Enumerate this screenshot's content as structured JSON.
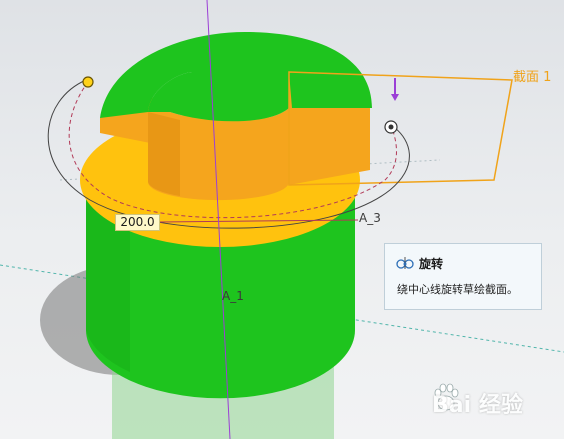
{
  "viewport": {
    "section_label": "截面 1",
    "dimension_value": "200.0",
    "axis_labels": {
      "a3": "A_3",
      "a1": "A_1"
    }
  },
  "tooltip": {
    "icon": "revolve-icon",
    "title": "旋转",
    "description": "绕中心线旋转草绘截面。"
  },
  "watermark": {
    "text": "Bai 经验",
    "logo": "baidu-paw-logo"
  },
  "colors": {
    "body_green": "#1ec41e",
    "section_orange": "#f5a51d",
    "annulus_yellow": "#ffc20e",
    "axis_purple": "#9b3fd6",
    "section_outline": "#f0a31a"
  }
}
